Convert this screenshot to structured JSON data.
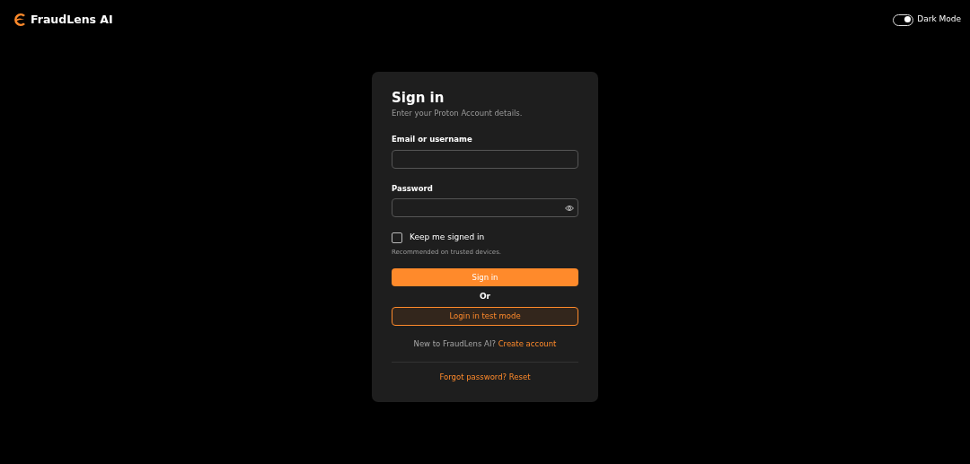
{
  "brand": {
    "name": "FraudLens AI"
  },
  "theme_toggle": {
    "label": "Dark Mode",
    "on": true
  },
  "card": {
    "title": "Sign in",
    "subtitle": "Enter your Proton Account details.",
    "fields": [
      {
        "label": "Email or username",
        "kind": "text"
      },
      {
        "label": "Password",
        "kind": "password"
      }
    ],
    "remember": {
      "label": "Keep me signed in",
      "checked": false,
      "hint": "Recommended on trusted devices."
    },
    "primary_button": "Sign in",
    "separator": "Or",
    "secondary_button": "Login in test mode",
    "signup": {
      "text": "New to FraudLens AI?",
      "link": "Create account"
    },
    "forgot_link": "Forgot password? Reset"
  }
}
